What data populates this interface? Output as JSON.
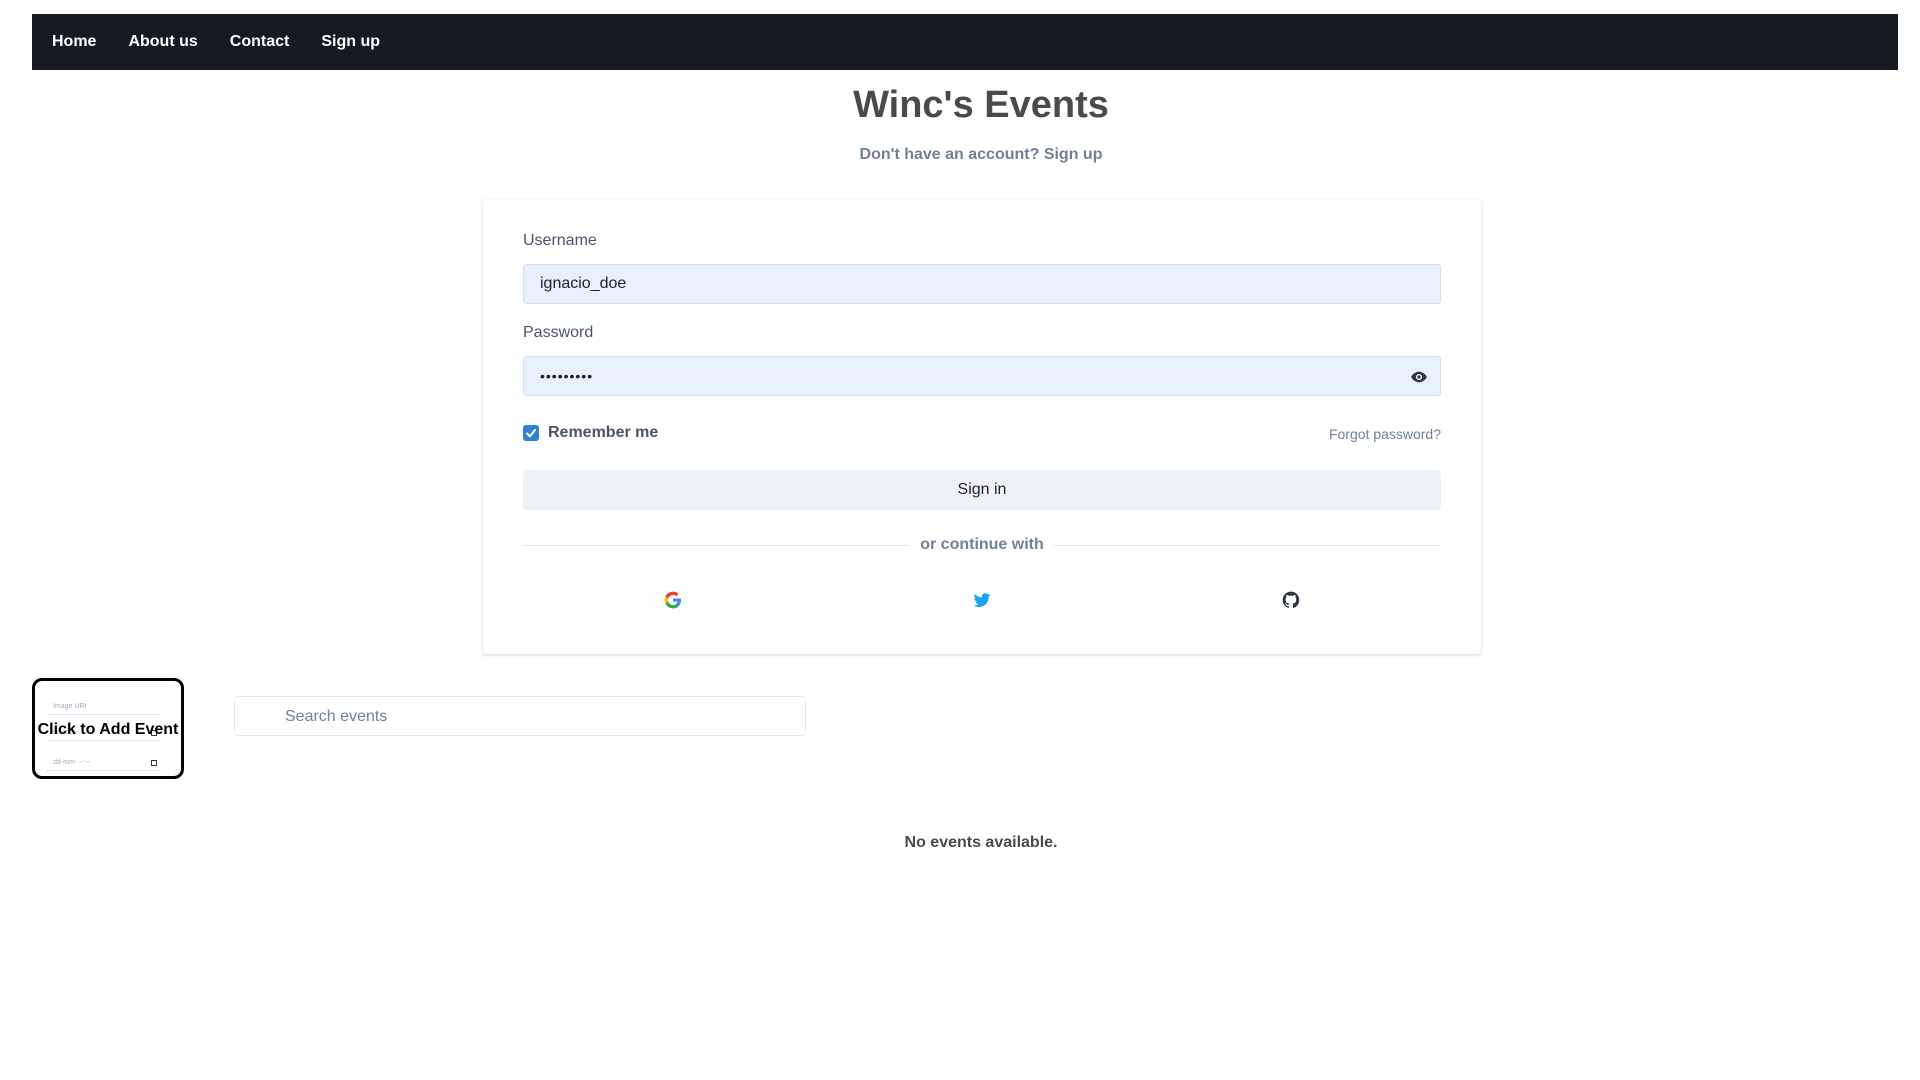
{
  "nav": {
    "items": [
      {
        "label": "Home"
      },
      {
        "label": "About us"
      },
      {
        "label": "Contact"
      },
      {
        "label": "Sign up"
      }
    ]
  },
  "header": {
    "title": "Winc's Events",
    "signup_prompt": "Don't have an account?",
    "signup_link": "Sign up"
  },
  "login": {
    "username_label": "Username",
    "username_value": "ignacio_doe",
    "password_label": "Password",
    "password_value": "•••••••••",
    "remember_label": "Remember me",
    "remember_checked": true,
    "forgot_label": "Forgot password?",
    "signin_label": "Sign in",
    "divider_text": "or continue with",
    "providers": [
      "google-icon",
      "twitter-icon",
      "github-icon"
    ]
  },
  "events": {
    "add_label": "Click to Add Event",
    "form_preview": {
      "image_placeholder": "Image URI",
      "date_placeholder": "dd-mm-",
      "datetime_placeholder": "dd-mm-",
      "time_placeholder": "--:--"
    },
    "search_placeholder": "Search events",
    "empty_message": "No events available."
  },
  "colors": {
    "navbar": "#171a23",
    "input_fill": "#e8f0fe",
    "checkbox": "#3182ce",
    "twitter": "#1da1f2"
  }
}
